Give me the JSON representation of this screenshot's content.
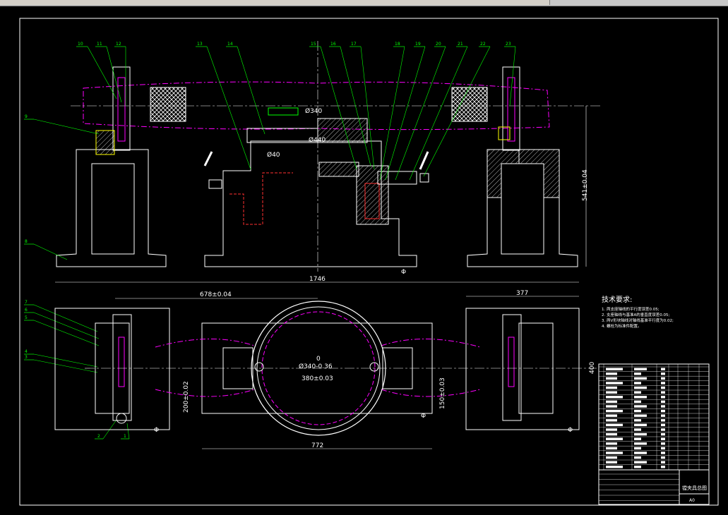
{
  "window": {
    "toolbar_segments": 6
  },
  "colors": {
    "background": "#000000",
    "white": "#ffffff",
    "green": "#00ff00",
    "magenta": "#ff00ff",
    "yellow": "#ffff00",
    "red": "#ff3030",
    "cyan": "#00ffff",
    "grey": "#9a9a9a"
  },
  "drawing": {
    "balloons_top": [
      "10",
      "11",
      "12",
      "13",
      "14",
      "15",
      "16",
      "17",
      "18",
      "19",
      "20",
      "21",
      "22",
      "23"
    ],
    "balloons_left": [
      "9",
      "8",
      "7",
      "6",
      "5",
      "4",
      "3"
    ],
    "balloons_bottom": [
      "2",
      "1"
    ],
    "dimensions": {
      "d340_top": "Ø340",
      "d440": "Ø440",
      "d40": "Ø40",
      "h541": "541±0.04",
      "w1746": "1746",
      "w678": "678±0.04",
      "w377": "377",
      "h200": "200±0.02",
      "h400": "400",
      "d340_plan": "Ø340-0.36",
      "zero": "0",
      "w380": "380±0.03",
      "h150": "150±0.03",
      "w772": "772",
      "datum": "Φ"
    },
    "tech_req": {
      "title": "技术要求:",
      "lines": [
        "1. 两支座轴线的平行度误差0.05;",
        "2. 支座轴线与基准A的垂直度误差0.05;",
        "3. 两V形块轴线对轴线基准平行度为0.02;",
        "4. 螺栓为标准件配置。"
      ]
    },
    "title_block": {
      "name": "镗夹具总图",
      "sheet": "A0"
    }
  }
}
